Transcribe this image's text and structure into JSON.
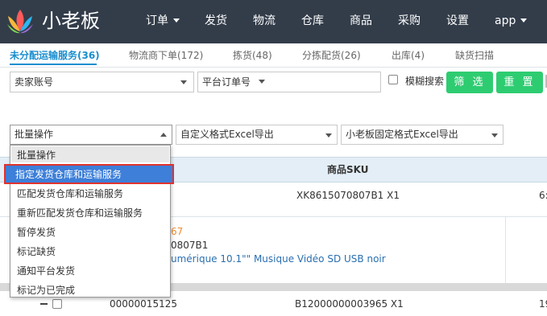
{
  "brand": {
    "name": "小老板"
  },
  "nav": {
    "items": [
      {
        "label": "订单",
        "dropdown": true
      },
      {
        "label": "发货",
        "dropdown": false
      },
      {
        "label": "物流",
        "dropdown": false
      },
      {
        "label": "仓库",
        "dropdown": false
      },
      {
        "label": "商品",
        "dropdown": false
      },
      {
        "label": "采购",
        "dropdown": false
      },
      {
        "label": "设置",
        "dropdown": false
      },
      {
        "label": "app",
        "dropdown": true
      }
    ]
  },
  "tabs": [
    {
      "label": "未分配运输服务(36)",
      "active": true
    },
    {
      "label": "物流商下单(172)",
      "active": false
    },
    {
      "label": "拣货(48)",
      "active": false
    },
    {
      "label": "分拣配货(26)",
      "active": false
    },
    {
      "label": "出库(4)",
      "active": false
    },
    {
      "label": "缺货扫描",
      "active": false
    }
  ],
  "filters": {
    "seller_account": "卖家账号",
    "platform_order_no": "平台订单号",
    "fuzzy_search": "模糊搜索",
    "filter_button": "筛 选",
    "reset_button": "重 置"
  },
  "actions": {
    "batch": "批量操作",
    "custom_excel": "自定义格式Excel导出",
    "fixed_excel": "小老板固定格式Excel导出"
  },
  "batch_menu": {
    "options": [
      "批量操作",
      "指定发货仓库和运输服务",
      "匹配发货仓库和运输服务",
      "重新匹配发货仓库和运输服务",
      "暂停发货",
      "标记缺货",
      "通知平台发货",
      "标记为已完成"
    ],
    "selected_index": 1
  },
  "table": {
    "column_sku": "商品SKU",
    "rows": [
      {
        "sku": "XK8615070807B1 X1",
        "right_value": "6:"
      },
      {
        "order_fragment": "67",
        "sku_fragment": "0807B1",
        "title_fragment": "umérique 10.1\"\" Musique Vidéo SD USB noir"
      },
      {
        "order_no": "00000015125",
        "sku": "B12000000003965 X1",
        "right_value": "19"
      }
    ]
  },
  "colors": {
    "header_bg": "#333d4a",
    "accent_blue": "#1a8ecf",
    "button_green": "#2ecc71",
    "selected_blue": "#3d7fd9",
    "highlight_red": "#e0322e",
    "order_orange": "#f08c2e"
  }
}
